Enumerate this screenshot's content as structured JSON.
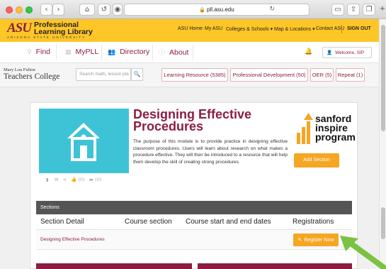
{
  "browser": {
    "url": "pll.asu.edu",
    "back_glyph": "‹",
    "forward_glyph": "›",
    "home_glyph": "⌂",
    "history_glyph": "↺",
    "shield_glyph": "◉",
    "reload_glyph": "↻",
    "lock_glyph": "🔒",
    "new_tab_glyph": "+"
  },
  "asu_header": {
    "logo": "ASU",
    "title_line1": "Professional",
    "title_line2": "Learning Library",
    "subtitle": "ARIZONA STATE UNIVERSITY",
    "links": [
      "ASU Home",
      "My ASU",
      "Colleges & Schools ▾",
      "Map & Locations ▾",
      "Contact ASU"
    ],
    "sign_out": "SIGN OUT"
  },
  "main_nav": {
    "items": [
      {
        "label": "Find",
        "icon": "search-icon",
        "glyph": "⚲"
      },
      {
        "label": "MyPLL",
        "icon": "grid-icon",
        "glyph": "▦"
      },
      {
        "label": "Directory",
        "icon": "people-icon",
        "glyph": "👥"
      },
      {
        "label": "About",
        "icon": "info-icon",
        "glyph": "ⓘ"
      }
    ],
    "bell_glyph": "🔔",
    "welcome": "Welcome, SIP",
    "user_glyph": "👤"
  },
  "college_bar": {
    "logo_line1": "Mary Lou Fulton",
    "logo_line2": "Teachers College",
    "search_placeholder": "Search math, lesson pla",
    "search_glyph": "🔍",
    "filters": [
      "Learning Resource (5385)",
      "Professional Development (50)",
      "OER (5)",
      "Repeat (1)"
    ]
  },
  "module": {
    "title_line1": "Designing Effective",
    "title_line2": "Procedures",
    "description": "The purpose of this module is to provide practice in designing effective classroom procedures. Users will learn about research on what makes a procedure effective. They will then be introduced to a resource that will help them develop the skill of creating strong procedures.",
    "icons": {
      "bookmark": "▮",
      "email": "✉",
      "share": "⋖",
      "like": "👍 (0)",
      "comment": "▬ (0)"
    },
    "partner_logo": [
      "sanford",
      "inspire",
      "program"
    ],
    "add_section": "Add Section"
  },
  "sections": {
    "bar_label": "Sections",
    "headers": [
      "Section Detail",
      "Course section",
      "Course start and end dates",
      "Registrations"
    ],
    "rows": [
      {
        "title": "Designing Effective Procedures",
        "register": "Register Now",
        "register_glyph": "✎"
      }
    ]
  },
  "colors": {
    "asu_maroon": "#8c1d40",
    "asu_gold": "#ffc627",
    "orange_button": "#f5a623",
    "hero_teal": "#3ec3d6",
    "arrow_green": "#7cc242"
  }
}
